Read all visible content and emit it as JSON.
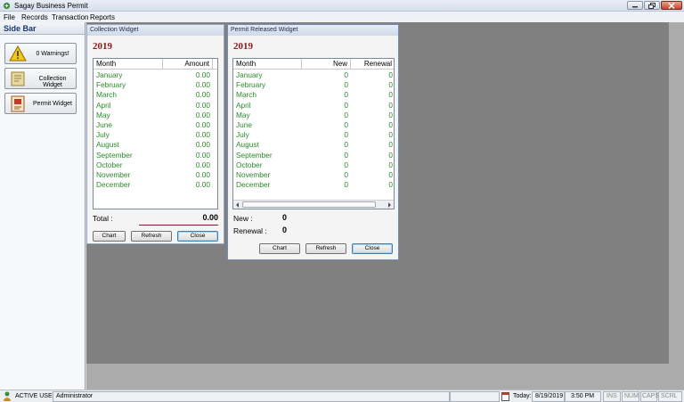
{
  "window": {
    "title": "Sagay Business Permit"
  },
  "menu": [
    "File",
    "Records",
    "Transaction",
    "Reports"
  ],
  "sidebar": {
    "title": "Side Bar",
    "buttons": [
      {
        "label": "0 Warnings!",
        "icon": "warning-icon"
      },
      {
        "label": "Collection Widget",
        "icon": "collection-icon"
      },
      {
        "label": "Permit Widget",
        "icon": "permit-icon"
      }
    ]
  },
  "collection_widget": {
    "title": "Collection Widget",
    "year": "2019",
    "headers": [
      "Month",
      "Amount"
    ],
    "rows": [
      [
        "January",
        "0.00"
      ],
      [
        "February",
        "0.00"
      ],
      [
        "March",
        "0.00"
      ],
      [
        "April",
        "0.00"
      ],
      [
        "May",
        "0.00"
      ],
      [
        "June",
        "0.00"
      ],
      [
        "July",
        "0.00"
      ],
      [
        "August",
        "0.00"
      ],
      [
        "September",
        "0.00"
      ],
      [
        "October",
        "0.00"
      ],
      [
        "November",
        "0.00"
      ],
      [
        "December",
        "0.00"
      ]
    ],
    "total_label": "Total :",
    "total_value": "0.00",
    "buttons": {
      "chart": "Chart",
      "refresh": "Refresh",
      "close": "Close"
    }
  },
  "permit_widget": {
    "title": "Permit Released Widget",
    "year": "2019",
    "headers": [
      "Month",
      "New",
      "Renewal"
    ],
    "rows": [
      [
        "January",
        "0",
        "0"
      ],
      [
        "February",
        "0",
        "0"
      ],
      [
        "March",
        "0",
        "0"
      ],
      [
        "April",
        "0",
        "0"
      ],
      [
        "May",
        "0",
        "0"
      ],
      [
        "June",
        "0",
        "0"
      ],
      [
        "July",
        "0",
        "0"
      ],
      [
        "August",
        "0",
        "0"
      ],
      [
        "September",
        "0",
        "0"
      ],
      [
        "October",
        "0",
        "0"
      ],
      [
        "November",
        "0",
        "0"
      ],
      [
        "December",
        "0",
        "0"
      ]
    ],
    "new_label": "New :",
    "new_value": "0",
    "renewal_label": "Renewal :",
    "renewal_value": "0",
    "buttons": {
      "chart": "Chart",
      "refresh": "Refresh",
      "close": "Close"
    }
  },
  "statusbar": {
    "active_user_label": "ACTIVE USER:",
    "active_user": "Administrator",
    "today_label": "Today:",
    "date": "8/19/2019",
    "time": "3:50 PM",
    "indicators": [
      "INS",
      "NUM",
      "CAPS",
      "SCRL"
    ]
  }
}
